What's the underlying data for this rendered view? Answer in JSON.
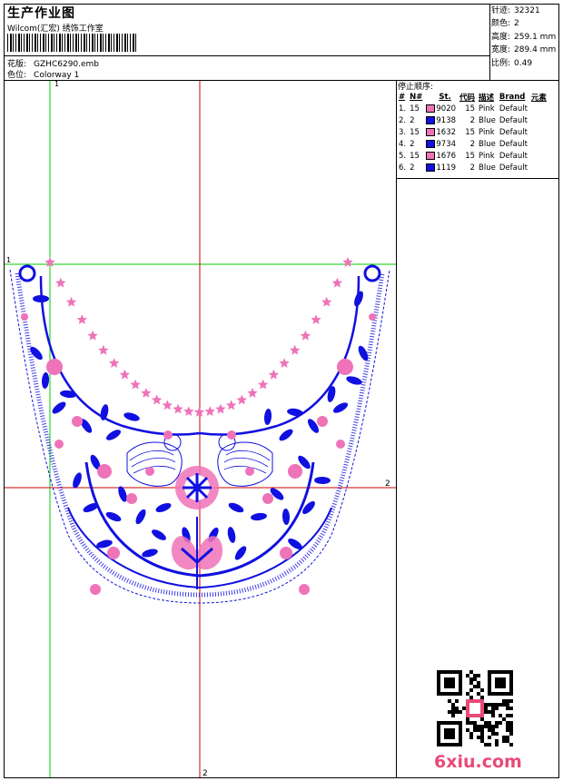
{
  "header": {
    "title": "生产作业图",
    "company": "Wilcom(汇宏) 绣饰工作室",
    "design_label": "花版:",
    "design_value": "GZHC6290.emb",
    "colorway_label": "色位:",
    "colorway_value": "Colorway 1"
  },
  "stats": [
    {
      "label": "针迹:",
      "value": "32321"
    },
    {
      "label": "颜色:",
      "value": "2"
    },
    {
      "label": "高度:",
      "value": "259.1 mm"
    },
    {
      "label": "宽度:",
      "value": "289.4 mm"
    },
    {
      "label": "比例:",
      "value": "0.49"
    }
  ],
  "stop_sequence": {
    "title": "停止顺序:",
    "columns": [
      "#",
      "N#",
      "St.",
      "代码",
      "描述",
      "Brand",
      "元素"
    ],
    "rows": [
      {
        "num": "1.",
        "n": "15",
        "color": "#ee73b9",
        "code": "9020",
        "st": "15",
        "desc": "Pink",
        "brand": "Default"
      },
      {
        "num": "2.",
        "n": "2",
        "color": "#1010e0",
        "code": "9138",
        "st": "2",
        "desc": "Blue",
        "brand": "Default"
      },
      {
        "num": "3.",
        "n": "15",
        "color": "#ee73b9",
        "code": "1632",
        "st": "15",
        "desc": "Pink",
        "brand": "Default"
      },
      {
        "num": "4.",
        "n": "2",
        "color": "#1010e0",
        "code": "9734",
        "st": "2",
        "desc": "Blue",
        "brand": "Default"
      },
      {
        "num": "5.",
        "n": "15",
        "color": "#ee73b9",
        "code": "1676",
        "st": "15",
        "desc": "Pink",
        "brand": "Default"
      },
      {
        "num": "6.",
        "n": "2",
        "color": "#1010e0",
        "code": "1119",
        "st": "2",
        "desc": "Blue",
        "brand": "Default"
      }
    ]
  },
  "markers": {
    "one_top": "1",
    "one_left": "1",
    "two_right": "2",
    "two_bottom": "2"
  },
  "watermark": "6xiu.com",
  "colors": {
    "pink": "#ee73b9",
    "blue": "#1010e0",
    "guide_green": "#00cc00",
    "guide_red": "#cc0000"
  }
}
